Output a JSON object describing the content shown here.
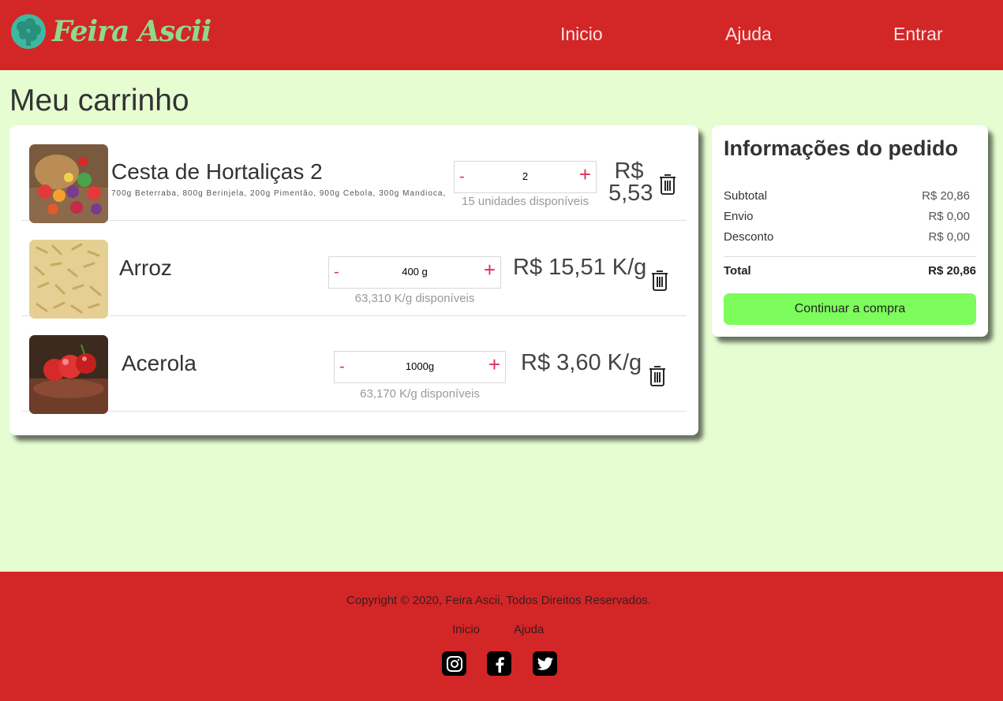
{
  "brand": {
    "name": "Feira Ascii",
    "logo_icon": "broccoli-logo-icon"
  },
  "nav": {
    "home": "Inicio",
    "help": "Ajuda",
    "login": "Entrar"
  },
  "page_title": "Meu carrinho",
  "cart": {
    "items": [
      {
        "name": "Cesta de Hortaliças 2",
        "description": "700g Beterraba, 800g Berinjela, 200g Pimentão, 900g Cebola, 300g Mandioca,",
        "qty_minus": "-",
        "qty_plus": "+",
        "quantity": "2",
        "available": "15 unidades disponíveis",
        "price": "R$ 5,53",
        "price_line1": "R$",
        "price_line2": "5,53"
      },
      {
        "name": "Arroz",
        "qty_minus": "-",
        "qty_plus": "+",
        "quantity": "400 g",
        "available": "63,310 K/g disponíveis",
        "price": "R$ 15,51 K/g"
      },
      {
        "name": "Acerola",
        "qty_minus": "-",
        "qty_plus": "+",
        "quantity": "1000g",
        "available": "63,170 K/g disponíveis",
        "price": "R$ 3,60 K/g"
      }
    ]
  },
  "summary": {
    "title": "Informações do pedido",
    "subtotal_label": "Subtotal",
    "subtotal_value": "R$ 20,86",
    "shipping_label": "Envio",
    "shipping_value": "R$ 0,00",
    "discount_label": "Desconto",
    "discount_value": "R$ 0,00",
    "total_label": "Total",
    "total_value": "R$ 20,86",
    "continue_button": "Continuar a compra"
  },
  "footer": {
    "copyright": "Copyright © 2020, Feira Ascii, Todos Direitos Reservados.",
    "home": "Inicio",
    "help": "Ajuda",
    "social_icons": [
      "instagram-icon",
      "facebook-icon",
      "twitter-icon"
    ]
  },
  "colors": {
    "header_bg": "#d32627",
    "page_bg": "#e6fdd1",
    "continue_button": "#7dfd5b",
    "qty_buttons": "#e0305a"
  }
}
